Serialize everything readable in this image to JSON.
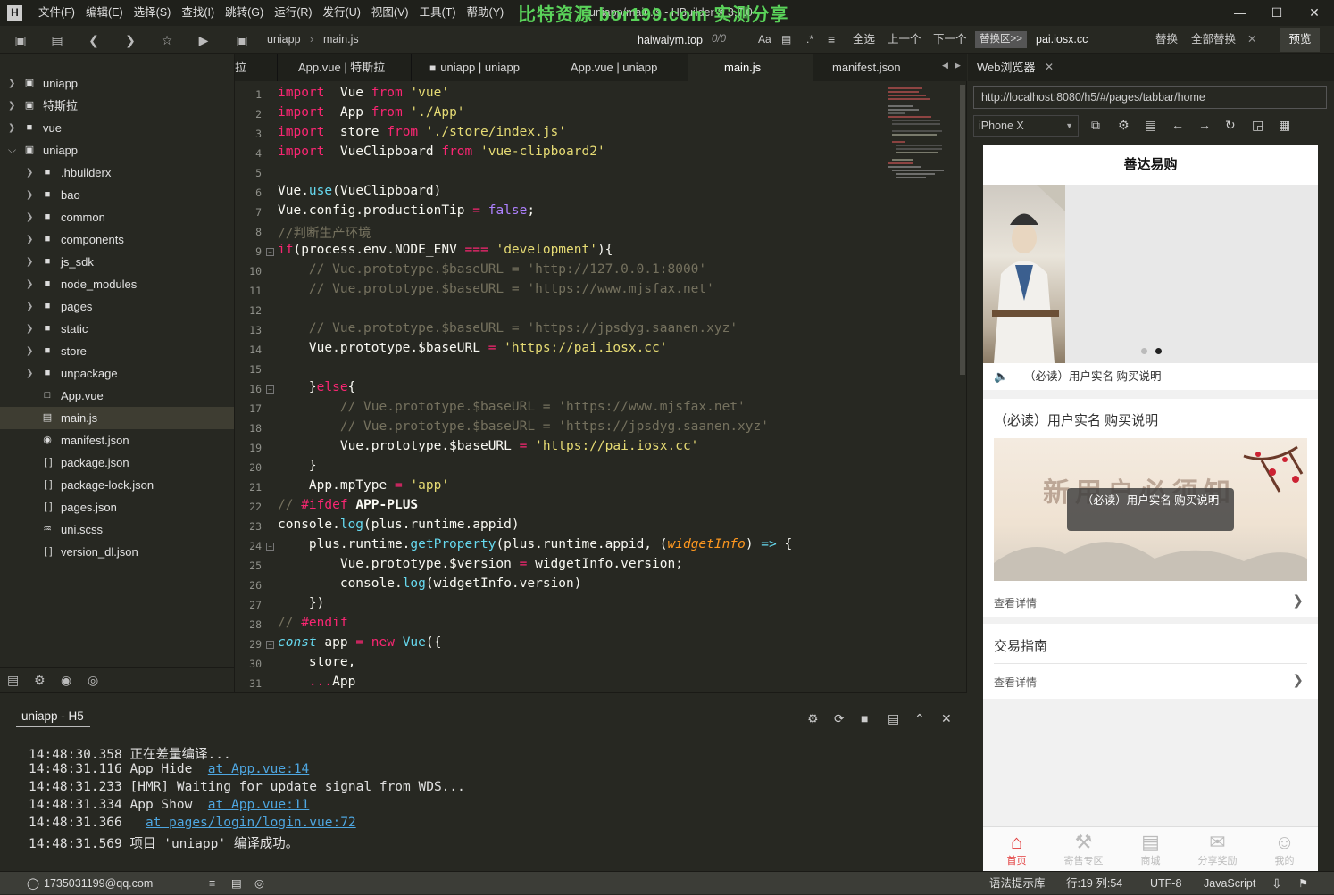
{
  "titlebar": {
    "menus": [
      "文件(F)",
      "编辑(E)",
      "选择(S)",
      "查找(I)",
      "跳转(G)",
      "运行(R)",
      "发行(U)",
      "视图(V)",
      "工具(T)",
      "帮助(Y)"
    ],
    "title": "uniapp/main.js - HBuilder X 3.7.0",
    "watermark": "比特资源 bor199.com 实测分享"
  },
  "toolbar": {
    "breadcrumb": [
      "uniapp",
      "main.js"
    ],
    "find_value": "haiwaiym.top",
    "find_count": "0/0",
    "find_all": "全选",
    "find_prev": "上一个",
    "find_next": "下一个",
    "replace_toggle": "替换区>>",
    "replace_value": "pai.iosx.cc",
    "replace": "替换",
    "replace_all": "全部替换",
    "preview": "预览"
  },
  "sidebar": {
    "items": [
      {
        "label": "uniapp",
        "icon": "project-icon",
        "level": 0,
        "expanded": false
      },
      {
        "label": "特斯拉",
        "icon": "project-icon",
        "level": 0,
        "expanded": false
      },
      {
        "label": "vue",
        "icon": "folder-icon",
        "level": 0,
        "expanded": false
      },
      {
        "label": "uniapp",
        "icon": "project-icon",
        "level": 0,
        "expanded": true
      },
      {
        "label": ".hbuilderx",
        "icon": "folder-icon",
        "level": 1
      },
      {
        "label": "bao",
        "icon": "folder-icon",
        "level": 1
      },
      {
        "label": "common",
        "icon": "folder-icon",
        "level": 1
      },
      {
        "label": "components",
        "icon": "folder-icon",
        "level": 1
      },
      {
        "label": "js_sdk",
        "icon": "folder-icon",
        "level": 1
      },
      {
        "label": "node_modules",
        "icon": "folder-icon",
        "level": 1
      },
      {
        "label": "pages",
        "icon": "folder-icon",
        "level": 1
      },
      {
        "label": "static",
        "icon": "folder-icon",
        "level": 1
      },
      {
        "label": "store",
        "icon": "folder-icon",
        "level": 1
      },
      {
        "label": "unpackage",
        "icon": "folder-icon",
        "level": 1
      },
      {
        "label": "App.vue",
        "icon": "vue-file-icon",
        "level": 1
      },
      {
        "label": "main.js",
        "icon": "js-file-icon",
        "level": 1,
        "selected": true
      },
      {
        "label": "manifest.json",
        "icon": "manifest-file-icon",
        "level": 1
      },
      {
        "label": "package.json",
        "icon": "json-file-icon",
        "level": 1
      },
      {
        "label": "package-lock.json",
        "icon": "json-file-icon",
        "level": 1
      },
      {
        "label": "pages.json",
        "icon": "json-file-icon",
        "level": 1
      },
      {
        "label": "uni.scss",
        "icon": "scss-file-icon",
        "level": 1
      },
      {
        "label": "version_dl.json",
        "icon": "json-file-icon",
        "level": 1
      }
    ]
  },
  "tabs": [
    {
      "label": "拉"
    },
    {
      "label": "App.vue | 特斯拉"
    },
    {
      "label": "uniapp | uniapp"
    },
    {
      "label": "App.vue | uniapp"
    },
    {
      "label": "main.js",
      "active": true
    },
    {
      "label": "manifest.json"
    }
  ],
  "code_lines": [
    [
      [
        "kw",
        "import"
      ],
      [
        "",
        "  Vue "
      ],
      [
        "kw",
        "from"
      ],
      [
        "st",
        " 'vue'"
      ]
    ],
    [
      [
        "kw",
        "import"
      ],
      [
        "",
        "  App "
      ],
      [
        "kw",
        "from"
      ],
      [
        "st",
        " './App'"
      ]
    ],
    [
      [
        "kw",
        "import"
      ],
      [
        "",
        "  store "
      ],
      [
        "kw",
        "from"
      ],
      [
        "st",
        " './store/index.js'"
      ]
    ],
    [
      [
        "kw",
        "import"
      ],
      [
        "",
        "  VueClipboard "
      ],
      [
        "kw",
        "from"
      ],
      [
        "st",
        " 'vue-clipboard2'"
      ]
    ],
    [],
    [
      [
        "",
        "Vue."
      ],
      [
        "fn",
        "use"
      ],
      [
        "",
        "(VueClipboard)"
      ]
    ],
    [
      [
        "",
        "Vue.config.productionTip "
      ],
      [
        "kw",
        "="
      ],
      [
        "pu",
        " false"
      ],
      [
        "",
        ";"
      ]
    ],
    [
      [
        "cm",
        "//判断生产环境"
      ]
    ],
    [
      [
        "kw",
        "if"
      ],
      [
        "",
        "(process.env.NODE_ENV "
      ],
      [
        "kw",
        "==="
      ],
      [
        "st",
        " 'development'"
      ],
      [
        "",
        "){"
      ]
    ],
    [
      [
        "cm",
        "    // Vue.prototype.$baseURL = 'http://127.0.0.1:8000'"
      ]
    ],
    [
      [
        "cm",
        "    // Vue.prototype.$baseURL = 'https://www.mjsfax.net'"
      ]
    ],
    [],
    [
      [
        "cm",
        "    // Vue.prototype.$baseURL = 'https://jpsdyg.saanen.xyz'"
      ]
    ],
    [
      [
        "",
        "    Vue.prototype.$baseURL "
      ],
      [
        "kw",
        "="
      ],
      [
        "st",
        " 'https://pai.iosx.cc'"
      ]
    ],
    [],
    [
      [
        "",
        "    }"
      ],
      [
        "kw",
        "else"
      ],
      [
        "",
        "{"
      ]
    ],
    [
      [
        "cm",
        "        // Vue.prototype.$baseURL = 'https://www.mjsfax.net'"
      ]
    ],
    [
      [
        "cm",
        "        // Vue.prototype.$baseURL = 'https://jpsdyg.saanen.xyz'"
      ]
    ],
    [
      [
        "",
        "        Vue.prototype.$baseURL "
      ],
      [
        "kw",
        "="
      ],
      [
        "st",
        " 'https://pai.iosx.cc'"
      ]
    ],
    [
      [
        "",
        "    }"
      ]
    ],
    [
      [
        "",
        "    App.mpType "
      ],
      [
        "kw",
        "="
      ],
      [
        "st",
        " 'app'"
      ]
    ],
    [
      [
        "cm",
        "// "
      ],
      [
        "kw",
        "#ifdef"
      ],
      [
        "bo",
        " APP-PLUS"
      ]
    ],
    [
      [
        "",
        "console."
      ],
      [
        "fn",
        "log"
      ],
      [
        "",
        "(plus.runtime.appid)"
      ]
    ],
    [
      [
        "",
        "    plus.runtime."
      ],
      [
        "fn",
        "getProperty"
      ],
      [
        "",
        "(plus.runtime.appid, ("
      ],
      [
        "it",
        "widgetInfo"
      ],
      [
        "",
        ") "
      ],
      [
        "fn",
        "=>"
      ],
      [
        "",
        " {"
      ]
    ],
    [
      [
        "",
        "        Vue.prototype.$version "
      ],
      [
        "kw",
        "="
      ],
      [
        "",
        " widgetInfo.version;"
      ]
    ],
    [
      [
        "",
        "        console."
      ],
      [
        "fn",
        "log"
      ],
      [
        "",
        "(widgetInfo.version)"
      ]
    ],
    [
      [
        "",
        "    })"
      ]
    ],
    [
      [
        "cm",
        "// "
      ],
      [
        "kw",
        "#endif"
      ]
    ],
    [
      [
        "ki",
        "const"
      ],
      [
        "",
        " app "
      ],
      [
        "kw",
        "="
      ],
      [
        "kw",
        " new"
      ],
      [
        "fn",
        " Vue"
      ],
      [
        "",
        "({"
      ]
    ],
    [
      [
        "",
        "    store,"
      ]
    ],
    [
      [
        "kw",
        "    ..."
      ],
      [
        "",
        "App"
      ]
    ]
  ],
  "console": {
    "tab": "uniapp - H5",
    "lines": [
      {
        "text": "14:48:30.358 正在差量编译...",
        "link": ""
      },
      {
        "text": "14:48:31.116 App Hide  ",
        "link": "at App.vue:14"
      },
      {
        "text": "14:48:31.233 [HMR] Waiting for update signal from WDS...",
        "link": ""
      },
      {
        "text": "14:48:31.334 App Show  ",
        "link": "at App.vue:11"
      },
      {
        "text": "14:48:31.366   ",
        "link": "at pages/login/login.vue:72"
      },
      {
        "text": "14:48:31.569 项目 'uniapp' 编译成功。",
        "link": ""
      }
    ]
  },
  "browser": {
    "tab": "Web浏览器",
    "url": "http://localhost:8080/h5/#/pages/tabbar/home",
    "device": "iPhone X",
    "phone": {
      "title": "善达易购",
      "carousel_index": 1,
      "carousel_count": 2,
      "notice": "（必读）用户实名 购买说明",
      "card1_title": "（必读）用户实名 购买说明",
      "card1_image_text": "新用户必须知",
      "toast": "（必读）用户实名 购买说明",
      "card1_link": "查看详情",
      "card2_title": "交易指南",
      "card2_link": "查看详情",
      "tabbar": [
        {
          "label": "首页",
          "icon": "home-icon",
          "active": true
        },
        {
          "label": "寄售专区",
          "icon": "hammer-icon"
        },
        {
          "label": "商城",
          "icon": "store-icon"
        },
        {
          "label": "分享奖励",
          "icon": "share-icon"
        },
        {
          "label": "我的",
          "icon": "user-icon"
        }
      ]
    }
  },
  "statusbar": {
    "account": "1735031199@qq.com",
    "syntax_hint": "语法提示库",
    "position": "行:19   列:54",
    "encoding": "UTF-8",
    "language": "JavaScript"
  }
}
